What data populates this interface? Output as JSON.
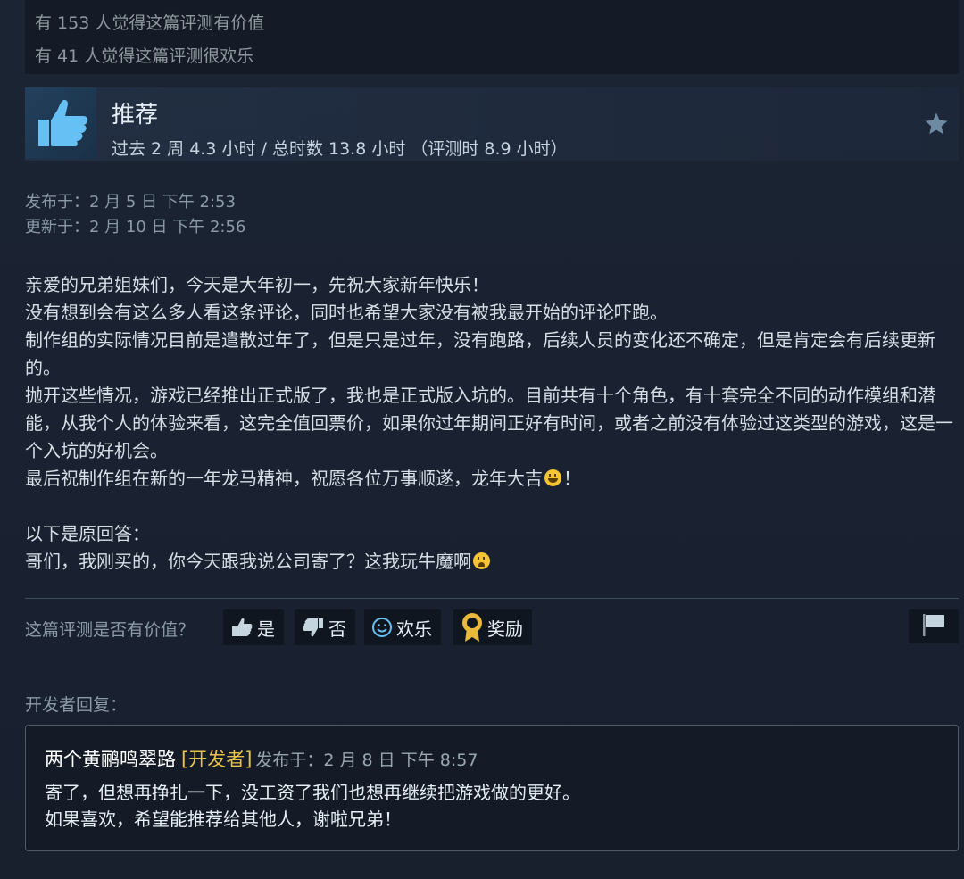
{
  "helpful_stats": {
    "line1": "有 153 人觉得这篇评测有价值",
    "line2": "有 41 人觉得这篇评测很欢乐"
  },
  "review_header": {
    "title": "推荐",
    "hours": "过去 2 周 4.3 小时 / 总时数 13.8 小时 （评测时 8.9 小时）",
    "icon": "thumbs-up-icon",
    "award_icon": "star-icon"
  },
  "dates": {
    "posted": "发布于：2 月 5 日 下午 2:53",
    "updated": "更新于：2 月 10 日 下午 2:56"
  },
  "review_body": {
    "p1": "亲爱的兄弟姐妹们，今天是大年初一，先祝大家新年快乐！",
    "p2": "没有想到会有这么多人看这条评论，同时也希望大家没有被我最开始的评论吓跑。",
    "p3": "制作组的实际情况目前是遣散过年了，但是只是过年，没有跑路，后续人员的变化还不确定，但是肯定会有后续更新的。",
    "p4": "抛开这些情况，游戏已经推出正式版了，我也是正式版入坑的。目前共有十个角色，有十套完全不同的动作模组和潜能，从我个人的体验来看，这完全值回票价，如果你过年期间正好有时间，或者之前没有体验过这类型的游戏，这是一个入坑的好机会。",
    "p5": "最后祝制作组在新的一年龙马精神，祝愿各位万事顺遂，龙年大吉",
    "p5_end": "！",
    "p6": "以下是原回答：",
    "p7": "哥们，我刚买的，你今天跟我说公司寄了？这我玩牛魔啊"
  },
  "vote": {
    "question": "这篇评测是否有价值？",
    "yes": "是",
    "no": "否",
    "funny": "欢乐",
    "award": "奖励"
  },
  "developer": {
    "label": "开发者回复：",
    "name": "两个黄鹂鸣翠路",
    "badge": "[开发者]",
    "date": "发布于：2 月 8 日 下午 8:57",
    "msg1": "寄了，但想再挣扎一下，没工资了我们也想再继续把游戏做的更好。",
    "msg2": "如果喜欢，希望能推荐给其他人，谢啦兄弟！"
  },
  "colors": {
    "accent_blue": "#66c0f4",
    "developer_badge": "#e8c24a",
    "award_gold": "#e9b93b"
  }
}
